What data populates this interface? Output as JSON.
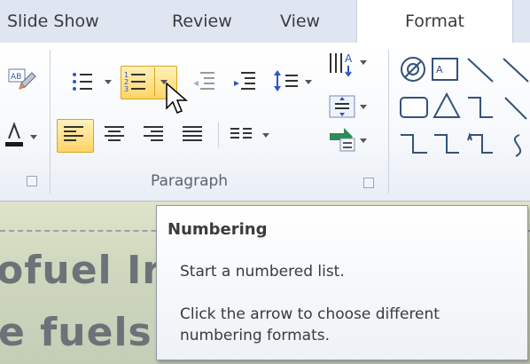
{
  "tabs": [
    {
      "label": "Slide Show"
    },
    {
      "label": "Review"
    },
    {
      "label": "View"
    },
    {
      "label": "Format"
    }
  ],
  "ribbon": {
    "paragraph_group_label": "Paragraph"
  },
  "tooltip": {
    "title": "Numbering",
    "line1": "Start a numbered list.",
    "line2": "Click the arrow to choose different",
    "line3": "numbering formats."
  },
  "slide": {
    "text_line1": "ofuel Ir",
    "text_line2": "e fuels"
  },
  "icons": {
    "bullets": "bullets-icon",
    "numbering": "numbering-icon",
    "decrease_indent": "decrease-indent-icon",
    "increase_indent": "increase-indent-icon",
    "line_spacing": "line-spacing-icon",
    "text_direction": "text-direction-icon",
    "align_text": "align-text-icon",
    "smartart": "convert-to-smartart-icon",
    "align_left": "align-left-icon",
    "center": "center-icon",
    "align_right": "align-right-icon",
    "justify": "justify-icon",
    "columns": "columns-icon",
    "mouse_cursor": "mouse-cursor-icon"
  },
  "colors": {
    "highlight": "#ffd467",
    "tab_bar": "#dfe6f2",
    "accent_arrow": "#2e8b57"
  }
}
